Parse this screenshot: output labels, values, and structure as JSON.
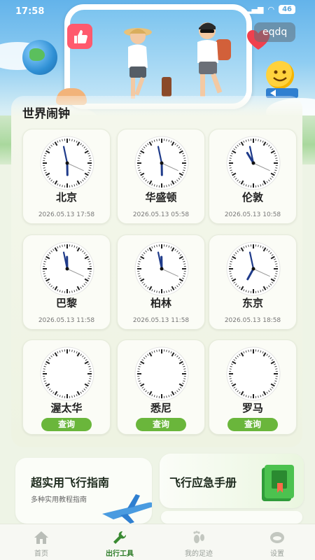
{
  "status_bar": {
    "time": "17:58",
    "battery": "46"
  },
  "user": {
    "name": "eqdq"
  },
  "section_title": "世界闹钟",
  "clocks": [
    {
      "city": "北京",
      "datetime": "2026.05.13 17:58",
      "hour": 17,
      "minute": 58
    },
    {
      "city": "华盛顿",
      "datetime": "2026.05.13 05:58",
      "hour": 5,
      "minute": 58
    },
    {
      "city": "伦敦",
      "datetime": "2026.05.13 10:58",
      "hour": 10,
      "minute": 58
    },
    {
      "city": "巴黎",
      "datetime": "2026.05.13 11:58",
      "hour": 11,
      "minute": 58
    },
    {
      "city": "柏林",
      "datetime": "2026.05.13 11:58",
      "hour": 11,
      "minute": 58
    },
    {
      "city": "东京",
      "datetime": "2026.05.13 18:58",
      "hour": 18,
      "minute": 58
    },
    {
      "city": "渥太华",
      "query": "查询"
    },
    {
      "city": "悉尼",
      "query": "查询"
    },
    {
      "city": "罗马",
      "query": "查询"
    }
  ],
  "promos": [
    {
      "title": "超实用飞行指南",
      "subtitle": "多种实用教程指南"
    },
    {
      "title": "飞行应急手册"
    }
  ],
  "nav": [
    {
      "label": "首页",
      "icon": "home-icon"
    },
    {
      "label": "出行工具",
      "icon": "tools-icon",
      "active": true
    },
    {
      "label": "我的足迹",
      "icon": "footprint-icon"
    },
    {
      "label": "设置",
      "icon": "settings-icon"
    }
  ],
  "colors": {
    "accent": "#6ab63b",
    "nav_active": "#2f7d2a"
  }
}
